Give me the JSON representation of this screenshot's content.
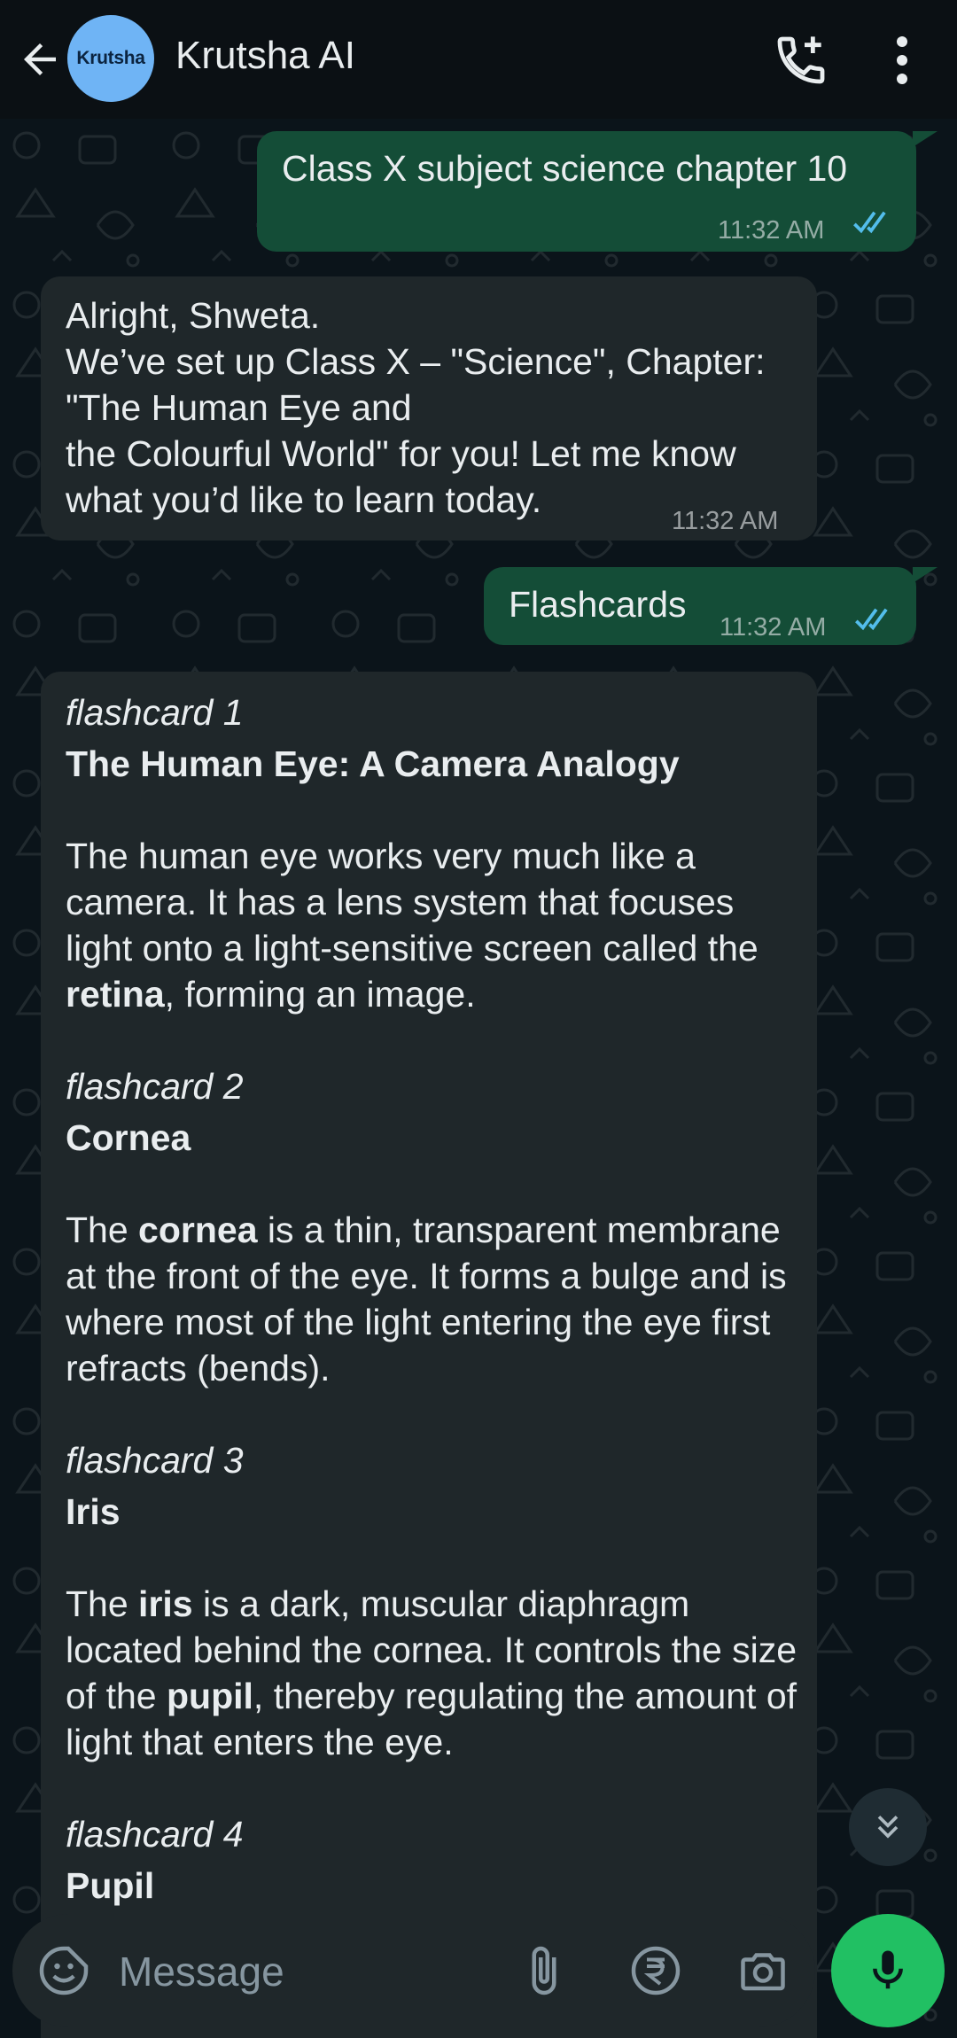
{
  "header": {
    "title": "Krutsha AI",
    "avatar_text": "Krutsha",
    "icons": {
      "back": "arrow-left-icon",
      "call": "add-call-icon",
      "menu": "more-vertical-icon"
    }
  },
  "colors": {
    "outgoing": "#144d37",
    "incoming": "#1f272a",
    "read_ticks": "#53bdeb",
    "mic": "#21c063"
  },
  "messages": [
    {
      "dir": "out",
      "text": "Class X subject science chapter 10",
      "time": "11:32 AM"
    },
    {
      "dir": "in",
      "lines": [
        "Alright, Shweta.",
        "We’ve set up Class X – \"Science\", Chapter: \"The Human Eye and",
        "the Colourful World\" for you! Let me know what you’d like to learn today."
      ],
      "time": "11:32 AM"
    },
    {
      "dir": "out",
      "text": "Flashcards",
      "time": "11:32 AM"
    }
  ],
  "flashcards": [
    {
      "label": "flashcard 1",
      "title": "The Human Eye: A Camera Analogy",
      "before": "The human eye works very much like a camera. It has a lens system that focuses light onto a light-sensitive screen called the ",
      "bold1": "retina",
      "after": ", forming an image."
    },
    {
      "label": "flashcard 2",
      "title": "Cornea",
      "before": "The ",
      "bold1": "cornea",
      "after": " is a thin, transparent membrane at the front of the eye. It forms a bulge and is where most of the light entering the eye first refracts (bends)."
    },
    {
      "label": "flashcard 3",
      "title": "Iris",
      "before": "The ",
      "bold1": "iris",
      "middle": " is a dark, muscular diaphragm located behind the cornea. It controls the size of the ",
      "bold2": "pupil",
      "after": ", thereby regulating the amount of light that enters the eye."
    },
    {
      "label": "flashcard 4",
      "title": "Pupil"
    }
  ],
  "composer": {
    "placeholder": "Message"
  }
}
